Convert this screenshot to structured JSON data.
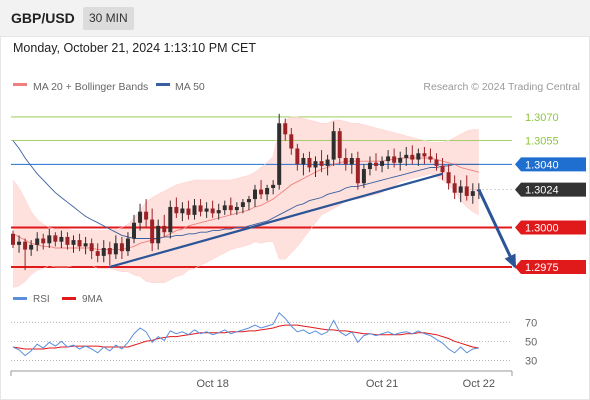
{
  "header": {
    "symbol": "GBP/USD",
    "timeframe": "30 MIN"
  },
  "timestamp": "Monday, October 21, 2024 1:13:10 PM CET",
  "colors": {
    "bullish": "#2e2e2e",
    "bearish": "#9b2226",
    "ma20": "#f08080",
    "bands_fill": "#fdd5d2",
    "ma50": "#3a5fa0",
    "trendline": "#2b5597",
    "arrow": "#2b5597",
    "support": "#e0191b",
    "resistance": "#8cc63f",
    "current_price_bg": "#333333",
    "ma50_label_bg": "#1f6fd1",
    "rsi": "#5b8fdc",
    "rsi_9ma": "#e0191b"
  },
  "chart_data": [
    {
      "type": "candlestick",
      "legend": [
        {
          "label": "MA 20 + Bollinger Bands",
          "color": "#f08080"
        },
        {
          "label": "MA 50",
          "color": "#3a5fa0"
        }
      ],
      "credit": "Research © 2024 Trading Central",
      "ylim": [
        1.2968,
        1.3082
      ],
      "levels": [
        {
          "value": "1.3070",
          "kind": "resistance"
        },
        {
          "value": "1.3055",
          "kind": "resistance"
        },
        {
          "value": "1.3040",
          "kind": "ma50"
        },
        {
          "value": "1.3024",
          "kind": "current"
        },
        {
          "value": "1.3000",
          "kind": "support"
        },
        {
          "value": "1.2975",
          "kind": "support"
        }
      ],
      "x_ticks": [
        "Oct 18",
        "Oct 21",
        "Oct 22"
      ],
      "x_tick_index": [
        33,
        61,
        77
      ],
      "candles": [
        [
          1.2996,
          1.2998,
          1.2987,
          1.2989
        ],
        [
          1.2989,
          1.2995,
          1.2984,
          1.2991
        ],
        [
          1.2991,
          1.2993,
          1.2973,
          1.2986
        ],
        [
          1.2986,
          1.2992,
          1.2982,
          1.2989
        ],
        [
          1.2989,
          1.2997,
          1.2985,
          1.2993
        ],
        [
          1.2993,
          1.2996,
          1.2986,
          1.299
        ],
        [
          1.299,
          1.2999,
          1.2987,
          1.2995
        ],
        [
          1.2995,
          1.2997,
          1.2988,
          1.2991
        ],
        [
          1.2991,
          1.2998,
          1.2987,
          1.2994
        ],
        [
          1.2994,
          1.2997,
          1.2986,
          1.2989
        ],
        [
          1.2989,
          1.2995,
          1.2984,
          1.2992
        ],
        [
          1.2992,
          1.2996,
          1.2985,
          1.2988
        ],
        [
          1.2988,
          1.2994,
          1.2983,
          1.299
        ],
        [
          1.299,
          1.2993,
          1.298,
          1.2985
        ],
        [
          1.2985,
          1.299,
          1.2978,
          1.2982
        ],
        [
          1.2982,
          1.2992,
          1.2978,
          1.2987
        ],
        [
          1.2987,
          1.2991,
          1.2976,
          1.2983
        ],
        [
          1.2983,
          1.2995,
          1.298,
          1.299
        ],
        [
          1.299,
          1.2994,
          1.298,
          1.2985
        ],
        [
          1.2985,
          1.2997,
          1.2982,
          1.2993
        ],
        [
          1.2993,
          1.3008,
          1.299,
          1.3003
        ],
        [
          1.3003,
          1.3015,
          1.2998,
          1.301
        ],
        [
          1.301,
          1.3018,
          1.3,
          1.3005
        ],
        [
          1.3005,
          1.3012,
          1.2985,
          1.299
        ],
        [
          1.299,
          1.3005,
          1.2986,
          1.3001
        ],
        [
          1.3001,
          1.3008,
          1.2994,
          1.2997
        ],
        [
          1.2997,
          1.3017,
          1.2993,
          1.3013
        ],
        [
          1.3013,
          1.3019,
          1.3006,
          1.3009
        ],
        [
          1.3009,
          1.3016,
          1.3004,
          1.3012
        ],
        [
          1.3012,
          1.3017,
          1.3005,
          1.3008
        ],
        [
          1.3008,
          1.3018,
          1.3005,
          1.3014
        ],
        [
          1.3014,
          1.3018,
          1.3007,
          1.301
        ],
        [
          1.301,
          1.3016,
          1.3006,
          1.3012
        ],
        [
          1.3012,
          1.3017,
          1.3006,
          1.3009
        ],
        [
          1.3009,
          1.3015,
          1.3005,
          1.3011
        ],
        [
          1.3011,
          1.3017,
          1.3008,
          1.3014
        ],
        [
          1.3014,
          1.3019,
          1.3008,
          1.3011
        ],
        [
          1.3011,
          1.3016,
          1.3008,
          1.3013
        ],
        [
          1.3013,
          1.3018,
          1.3009,
          1.3016
        ],
        [
          1.3016,
          1.302,
          1.3011,
          1.3018
        ],
        [
          1.3018,
          1.3027,
          1.3013,
          1.3024
        ],
        [
          1.3024,
          1.303,
          1.3018,
          1.3021
        ],
        [
          1.3021,
          1.3027,
          1.3017,
          1.3025
        ],
        [
          1.3025,
          1.303,
          1.3021,
          1.3027
        ],
        [
          1.3027,
          1.3072,
          1.3024,
          1.3066
        ],
        [
          1.3066,
          1.3069,
          1.3055,
          1.3059
        ],
        [
          1.3059,
          1.3063,
          1.3046,
          1.305
        ],
        [
          1.305,
          1.3053,
          1.3036,
          1.304
        ],
        [
          1.304,
          1.3047,
          1.3033,
          1.3044
        ],
        [
          1.3044,
          1.3048,
          1.3035,
          1.3038
        ],
        [
          1.3038,
          1.3045,
          1.3032,
          1.3042
        ],
        [
          1.3042,
          1.3049,
          1.3035,
          1.3039
        ],
        [
          1.3039,
          1.3046,
          1.3033,
          1.3043
        ],
        [
          1.3043,
          1.3067,
          1.3039,
          1.3061
        ],
        [
          1.3061,
          1.3063,
          1.304,
          1.3044
        ],
        [
          1.3044,
          1.305,
          1.3036,
          1.304
        ],
        [
          1.304,
          1.3047,
          1.3034,
          1.3044
        ],
        [
          1.3044,
          1.3048,
          1.3024,
          1.3028
        ],
        [
          1.3028,
          1.304,
          1.3025,
          1.3037
        ],
        [
          1.3037,
          1.3045,
          1.3033,
          1.3041
        ],
        [
          1.3041,
          1.3047,
          1.3036,
          1.3039
        ],
        [
          1.3039,
          1.3045,
          1.3035,
          1.3042
        ],
        [
          1.3042,
          1.3049,
          1.3037,
          1.3045
        ],
        [
          1.3045,
          1.305,
          1.3038,
          1.3041
        ],
        [
          1.3041,
          1.3048,
          1.3036,
          1.3044
        ],
        [
          1.3044,
          1.3051,
          1.3039,
          1.3046
        ],
        [
          1.3046,
          1.3052,
          1.304,
          1.3043
        ],
        [
          1.3043,
          1.305,
          1.3039,
          1.3047
        ],
        [
          1.3047,
          1.3051,
          1.304,
          1.3045
        ],
        [
          1.3045,
          1.305,
          1.3041,
          1.3043
        ],
        [
          1.3043,
          1.3047,
          1.3036,
          1.3039
        ],
        [
          1.3039,
          1.3044,
          1.303,
          1.3035
        ],
        [
          1.3035,
          1.304,
          1.3024,
          1.3028
        ],
        [
          1.3028,
          1.3033,
          1.3018,
          1.3022
        ],
        [
          1.3022,
          1.303,
          1.3016,
          1.3026
        ],
        [
          1.3026,
          1.3033,
          1.3017,
          1.302
        ],
        [
          1.302,
          1.3028,
          1.3015,
          1.3023
        ],
        [
          1.3023,
          1.3028,
          1.3018,
          1.3024
        ]
      ],
      "ma20": [
        1.2996,
        1.2994,
        1.2992,
        1.299,
        1.2989,
        1.2988,
        1.2988,
        1.2987,
        1.2987,
        1.2987,
        1.2987,
        1.2987,
        1.2987,
        1.2987,
        1.2986,
        1.2986,
        1.2986,
        1.2986,
        1.2986,
        1.2987,
        1.2988,
        1.299,
        1.2991,
        1.2992,
        1.2993,
        1.2994,
        1.2996,
        1.2998,
        1.2999,
        1.3001,
        1.3002,
        1.3003,
        1.3004,
        1.3005,
        1.3006,
        1.3007,
        1.3008,
        1.3009,
        1.301,
        1.3011,
        1.3013,
        1.3014,
        1.3016,
        1.3018,
        1.3021,
        1.3024,
        1.3027,
        1.3029,
        1.3031,
        1.3033,
        1.3035,
        1.3037,
        1.3038,
        1.304,
        1.3041,
        1.3042,
        1.3042,
        1.3042,
        1.3042,
        1.3042,
        1.3042,
        1.3042,
        1.3043,
        1.3043,
        1.3044,
        1.3044,
        1.3044,
        1.3044,
        1.3044,
        1.3044,
        1.3043,
        1.3042,
        1.3041,
        1.304,
        1.3038,
        1.3037,
        1.3036,
        1.3035
      ],
      "bb_upper": [
        1.303,
        1.3025,
        1.3018,
        1.301,
        1.3005,
        1.3002,
        1.3,
        1.2999,
        1.2999,
        1.2999,
        1.2998,
        1.2998,
        1.2998,
        1.2998,
        1.2998,
        1.2998,
        1.2998,
        1.2999,
        1.3,
        1.3002,
        1.3006,
        1.3011,
        1.3016,
        1.3019,
        1.3021,
        1.3023,
        1.3025,
        1.3027,
        1.3028,
        1.3029,
        1.303,
        1.303,
        1.303,
        1.303,
        1.303,
        1.303,
        1.303,
        1.3031,
        1.3032,
        1.3033,
        1.3035,
        1.3038,
        1.3041,
        1.3045,
        1.3062,
        1.3068,
        1.307,
        1.307,
        1.3069,
        1.3068,
        1.3067,
        1.3066,
        1.3066,
        1.3068,
        1.3068,
        1.3067,
        1.3066,
        1.3066,
        1.3065,
        1.3064,
        1.3063,
        1.3062,
        1.3061,
        1.306,
        1.3059,
        1.3058,
        1.3057,
        1.3056,
        1.3055,
        1.3054,
        1.3054,
        1.3054,
        1.3055,
        1.3057,
        1.3059,
        1.3061,
        1.3062,
        1.3062
      ],
      "bb_lower": [
        1.2962,
        1.2963,
        1.2966,
        1.297,
        1.2973,
        1.2974,
        1.2976,
        1.2975,
        1.2975,
        1.2975,
        1.2976,
        1.2976,
        1.2976,
        1.2976,
        1.2974,
        1.2974,
        1.2974,
        1.2973,
        1.2972,
        1.2972,
        1.297,
        1.2969,
        1.2966,
        1.2965,
        1.2965,
        1.2965,
        1.2967,
        1.2969,
        1.297,
        1.2973,
        1.2974,
        1.2976,
        1.2978,
        1.298,
        1.2982,
        1.2984,
        1.2986,
        1.2987,
        1.2988,
        1.2989,
        1.2991,
        1.299,
        1.2991,
        1.2991,
        1.298,
        1.298,
        1.2984,
        1.2988,
        1.2993,
        1.2998,
        1.3003,
        1.3008,
        1.301,
        1.3012,
        1.3014,
        1.3017,
        1.3018,
        1.3018,
        1.3019,
        1.302,
        1.3021,
        1.3022,
        1.3025,
        1.3026,
        1.3029,
        1.303,
        1.3031,
        1.3032,
        1.3033,
        1.3034,
        1.3032,
        1.303,
        1.3027,
        1.3023,
        1.3017,
        1.3013,
        1.301,
        1.3008
      ],
      "ma50": [
        1.3055,
        1.305,
        1.3044,
        1.3039,
        1.3034,
        1.303,
        1.3026,
        1.3022,
        1.3019,
        1.3016,
        1.3013,
        1.301,
        1.3007,
        1.3005,
        1.3003,
        1.3001,
        1.2999,
        1.2997,
        1.2995,
        1.2994,
        1.2993,
        1.2993,
        1.2993,
        1.2993,
        1.2993,
        1.2994,
        1.2994,
        1.2995,
        1.2995,
        1.2996,
        1.2996,
        1.2997,
        1.2997,
        1.2998,
        1.2998,
        1.2999,
        1.2999,
        1.3,
        1.3,
        1.3001,
        1.3002,
        1.3003,
        1.3004,
        1.3006,
        1.3008,
        1.301,
        1.3012,
        1.3014,
        1.3015,
        1.3017,
        1.3018,
        1.3019,
        1.3021,
        1.3022,
        1.3023,
        1.3025,
        1.3026,
        1.3026,
        1.3027,
        1.3028,
        1.3029,
        1.303,
        1.3031,
        1.3032,
        1.3033,
        1.3034,
        1.3035,
        1.3036,
        1.3037,
        1.3038,
        1.3038,
        1.3039,
        1.3039,
        1.304,
        1.304,
        1.304,
        1.304,
        1.304
      ],
      "trendline": [
        [
          16,
          1.2975
        ],
        [
          71,
          1.3034
        ]
      ],
      "forecast_arrow": [
        [
          77,
          1.3024
        ],
        [
          83,
          1.2975
        ]
      ]
    },
    {
      "type": "line",
      "legend": [
        {
          "label": "RSI",
          "color": "#5b8fdc"
        },
        {
          "label": "9MA",
          "color": "#e0191b"
        }
      ],
      "ylim": [
        22,
        85
      ],
      "y_ticks": [
        "70",
        "50",
        "30"
      ],
      "x_ticks": [
        "Oct 18",
        "Oct 21",
        "Oct 22"
      ],
      "rsi": [
        44,
        41,
        35,
        40,
        47,
        43,
        49,
        45,
        50,
        44,
        46,
        42,
        45,
        42,
        38,
        44,
        40,
        46,
        42,
        49,
        58,
        64,
        60,
        49,
        55,
        51,
        61,
        58,
        60,
        57,
        62,
        58,
        60,
        57,
        59,
        62,
        58,
        60,
        62,
        64,
        67,
        64,
        66,
        68,
        80,
        74,
        66,
        60,
        62,
        58,
        61,
        57,
        60,
        72,
        60,
        56,
        60,
        49,
        56,
        58,
        56,
        58,
        60,
        57,
        59,
        60,
        58,
        61,
        58,
        56,
        52,
        48,
        42,
        38,
        44,
        38,
        42,
        43
      ],
      "rsi_9ma": [
        44,
        43,
        42,
        42,
        42,
        42,
        43,
        43,
        44,
        44,
        45,
        45,
        45,
        45,
        45,
        44,
        44,
        44,
        44,
        44,
        46,
        48,
        50,
        51,
        53,
        54,
        55,
        55,
        56,
        57,
        58,
        59,
        59,
        59,
        59,
        59,
        60,
        60,
        60,
        61,
        61,
        62,
        63,
        64,
        66,
        67,
        67,
        67,
        66,
        65,
        64,
        63,
        62,
        62,
        61,
        61,
        60,
        59,
        58,
        58,
        57,
        57,
        57,
        57,
        57,
        58,
        58,
        59,
        59,
        58,
        57,
        55,
        53,
        50,
        48,
        46,
        44,
        43
      ]
    }
  ]
}
